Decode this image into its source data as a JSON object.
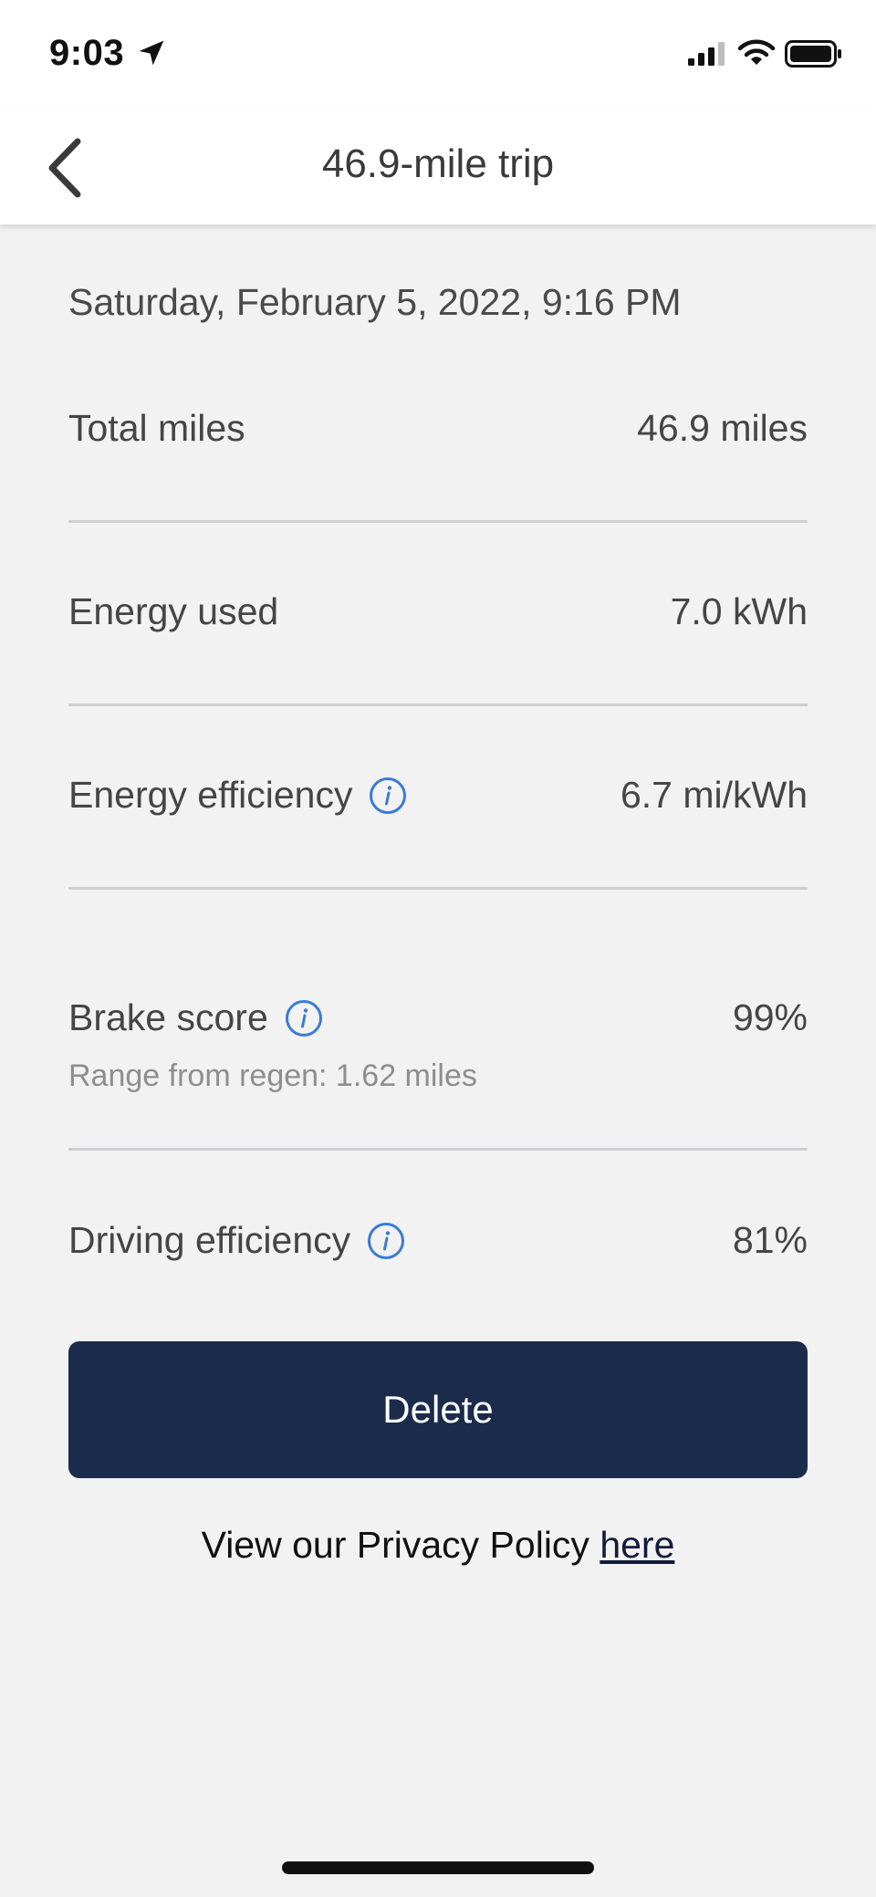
{
  "status_bar": {
    "time": "9:03"
  },
  "nav": {
    "title": "46.9-mile trip"
  },
  "trip": {
    "date": "Saturday, February 5, 2022, 9:16 PM"
  },
  "metrics": [
    {
      "label": "Total miles",
      "value": "46.9 miles"
    },
    {
      "label": "Energy used",
      "value": "7.0 kWh"
    },
    {
      "label": "Energy efficiency",
      "value": "6.7 mi/kWh"
    },
    {
      "label": "Brake score",
      "value": "99%",
      "sub": "Range from regen: 1.62 miles"
    },
    {
      "label": "Driving efficiency",
      "value": "81%"
    }
  ],
  "actions": {
    "delete_label": "Delete"
  },
  "privacy": {
    "text": "View our Privacy Policy ",
    "link_label": "here"
  },
  "colors": {
    "primary_button": "#1b2b4b",
    "info_icon": "#3b7bd4",
    "background": "#f2f2f3"
  }
}
